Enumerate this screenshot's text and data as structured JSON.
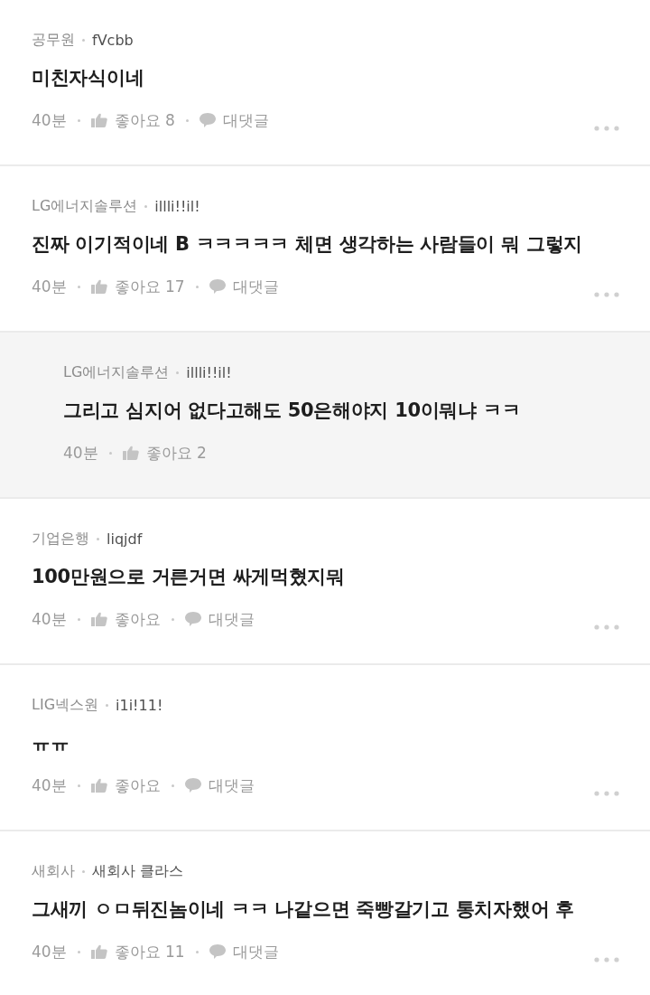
{
  "comments": [
    {
      "kind": "comment",
      "company": "공무원",
      "nickname": "fVcbb",
      "text": "미친자식이네",
      "time": "40분",
      "likes": "좋아요 8",
      "reply_label": "대댓글"
    },
    {
      "kind": "comment",
      "company": "LG에너지솔루션",
      "nickname": "illli!!il!",
      "text": "진짜 이기적이네 B ㅋㅋㅋㅋㅋ 체면 생각하는 사람들이 뭐 그렇지",
      "time": "40분",
      "likes": "좋아요 17",
      "reply_label": "대댓글"
    },
    {
      "kind": "reply",
      "company": "LG에너지솔루션",
      "nickname": "illli!!il!",
      "text": "그리고 심지어 없다고해도 50은해야지 10이뭐냐 ㅋㅋ",
      "time": "40분",
      "likes": "좋아요 2"
    },
    {
      "kind": "comment",
      "company": "기업은행",
      "nickname": "liqjdf",
      "text": "100만원으로 거른거면 싸게먹혔지뭐",
      "time": "40분",
      "likes": "좋아요",
      "reply_label": "대댓글"
    },
    {
      "kind": "comment",
      "company": "LIG넥스원",
      "nickname": "i1i!11!",
      "text": "ㅠㅠ",
      "time": "40분",
      "likes": "좋아요",
      "reply_label": "대댓글"
    },
    {
      "kind": "comment",
      "company": "새회사",
      "nickname": "새회사 클라스",
      "text": "그새끼 ㅇㅁ뒤진놈이네 ㅋㅋ 나같으면 죽빵갈기고 통치자했어 후",
      "time": "40분",
      "likes": "좋아요 11",
      "reply_label": "대댓글"
    }
  ]
}
